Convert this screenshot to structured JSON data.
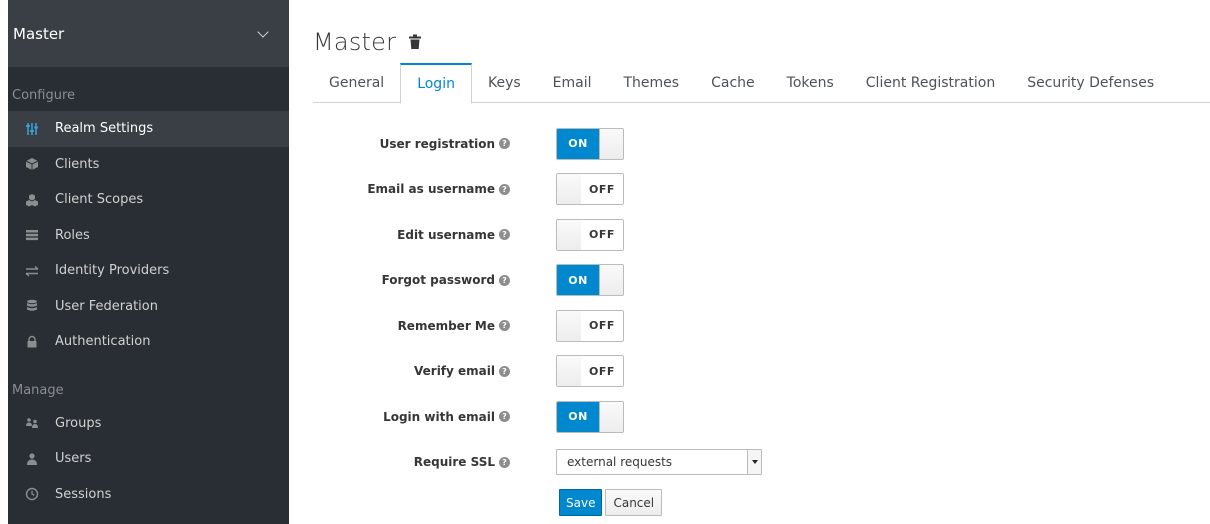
{
  "realm_selector": {
    "label": "Master",
    "icon": "chevron-down-icon"
  },
  "sidebar": {
    "configure_label": "Configure",
    "configure_items": [
      {
        "label": "Realm Settings",
        "icon": "sliders-icon",
        "active": true
      },
      {
        "label": "Clients",
        "icon": "cube-icon",
        "active": false
      },
      {
        "label": "Client Scopes",
        "icon": "cubes-icon",
        "active": false
      },
      {
        "label": "Roles",
        "icon": "list-icon",
        "active": false
      },
      {
        "label": "Identity Providers",
        "icon": "exchange-icon",
        "active": false
      },
      {
        "label": "User Federation",
        "icon": "database-icon",
        "active": false
      },
      {
        "label": "Authentication",
        "icon": "lock-icon",
        "active": false
      }
    ],
    "manage_label": "Manage",
    "manage_items": [
      {
        "label": "Groups",
        "icon": "users-group-icon"
      },
      {
        "label": "Users",
        "icon": "user-icon"
      },
      {
        "label": "Sessions",
        "icon": "clock-icon"
      }
    ]
  },
  "header": {
    "title": "Master",
    "delete_icon": "trash-icon"
  },
  "tabs": [
    {
      "label": "General",
      "active": false
    },
    {
      "label": "Login",
      "active": true
    },
    {
      "label": "Keys",
      "active": false
    },
    {
      "label": "Email",
      "active": false
    },
    {
      "label": "Themes",
      "active": false
    },
    {
      "label": "Cache",
      "active": false
    },
    {
      "label": "Tokens",
      "active": false
    },
    {
      "label": "Client Registration",
      "active": false
    },
    {
      "label": "Security Defenses",
      "active": false
    }
  ],
  "switch_labels": {
    "on": "ON",
    "off": "OFF"
  },
  "form": {
    "fields": [
      {
        "label": "User registration",
        "value": "ON"
      },
      {
        "label": "Email as username",
        "value": "OFF"
      },
      {
        "label": "Edit username",
        "value": "OFF"
      },
      {
        "label": "Forgot password",
        "value": "ON"
      },
      {
        "label": "Remember Me",
        "value": "OFF"
      },
      {
        "label": "Verify email",
        "value": "OFF"
      },
      {
        "label": "Login with email",
        "value": "ON"
      }
    ],
    "require_ssl": {
      "label": "Require SSL",
      "value": "external requests"
    },
    "save_label": "Save",
    "cancel_label": "Cancel"
  },
  "colors": {
    "accent": "#0088ce",
    "sidebar_bg": "#292e34",
    "sidebar_active": "#393f44"
  }
}
